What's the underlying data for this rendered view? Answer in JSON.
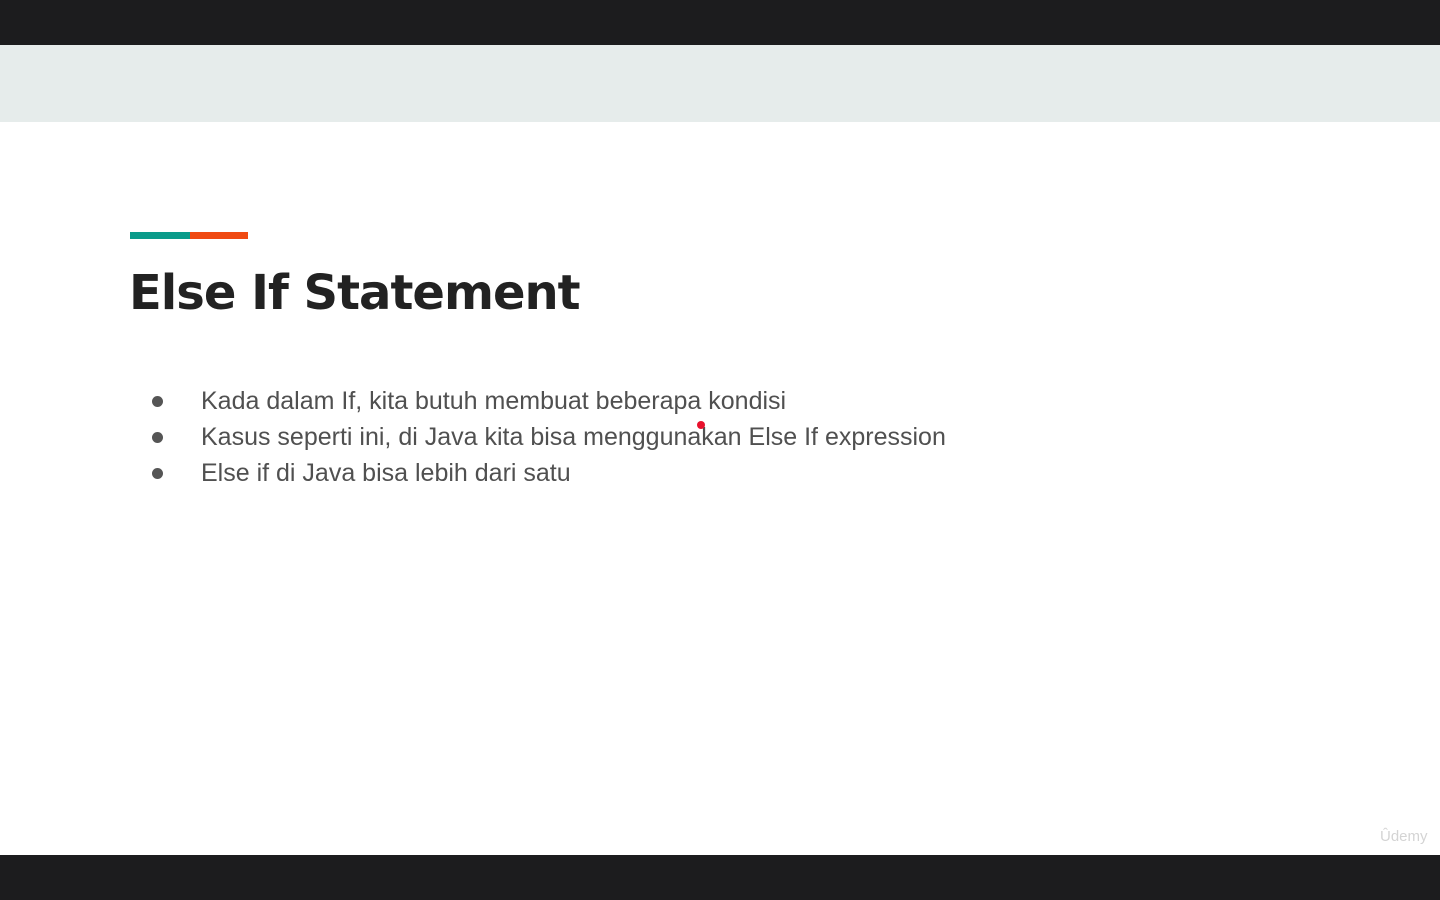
{
  "slide": {
    "title": "Else If Statement",
    "bullets": [
      "Kada dalam If, kita butuh membuat beberapa kondisi",
      "Kasus seperti ini, di Java kita bisa menggunakan Else If expression",
      "Else if di Java bisa lebih dari satu"
    ]
  },
  "watermark": "Ûdemy",
  "colors": {
    "accent_teal": "#0a9b8a",
    "accent_orange": "#f04a12",
    "laser_pointer": "#e8112d"
  }
}
